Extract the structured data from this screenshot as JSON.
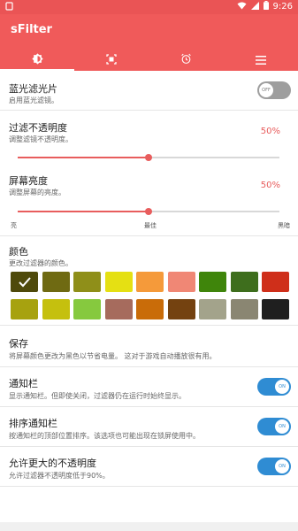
{
  "status_bar": {
    "time": "9:26"
  },
  "app": {
    "title": "sFilter"
  },
  "tabs": [
    {
      "icon": "brightness-icon",
      "active": true
    },
    {
      "icon": "dashed-square-icon",
      "active": false
    },
    {
      "icon": "alarm-icon",
      "active": false
    },
    {
      "icon": "menu-icon",
      "active": false
    }
  ],
  "blue_light": {
    "title": "蓝光滤光片",
    "subtitle": "启用蓝光滤镜。",
    "toggle_label": "OFF",
    "enabled": false
  },
  "opacity": {
    "title": "过滤不透明度",
    "subtitle": "调整滤镜不透明度。",
    "value_text": "50%",
    "value": 0.5
  },
  "brightness": {
    "title": "屏幕亮度",
    "subtitle": "调整屏幕的亮度。",
    "value_text": "50%",
    "value": 0.5,
    "label_left": "亮",
    "label_mid": "最佳",
    "label_right": "黑暗"
  },
  "color": {
    "title": "颜色",
    "subtitle": "更改过滤器的颜色。",
    "row1": [
      "#4f4a0b",
      "#6f6a12",
      "#8f8f19",
      "#e5e013",
      "#f59a3a",
      "#f08775",
      "#3f850b",
      "#3e6e1d",
      "#cf2f1a"
    ],
    "row2": [
      "#a7a20f",
      "#c5c00e",
      "#86c93e",
      "#a66b5d",
      "#c96c09",
      "#744210",
      "#a3a38b",
      "#8a8672",
      "#1f1f1f"
    ],
    "selected": 0
  },
  "save": {
    "title": "保存",
    "subtitle": "将屏幕颜色更改为黑色以节省电量。 这对于游戏自动播放很有用。"
  },
  "notification": {
    "title": "通知栏",
    "subtitle": "显示通知栏。但即使关闭，过滤器仍在运行时始终显示。",
    "toggle_label": "ON",
    "enabled": true
  },
  "sort_notification": {
    "title": "排序通知栏",
    "subtitle": "按通知栏的顶部位置排序。该选项也可能出现在锁屏使用中。",
    "toggle_label": "ON",
    "enabled": true
  },
  "max_opacity": {
    "title": "允许更大的不透明度",
    "subtitle": "允许过滤器不透明度低于90%。",
    "toggle_label": "ON",
    "enabled": true
  }
}
